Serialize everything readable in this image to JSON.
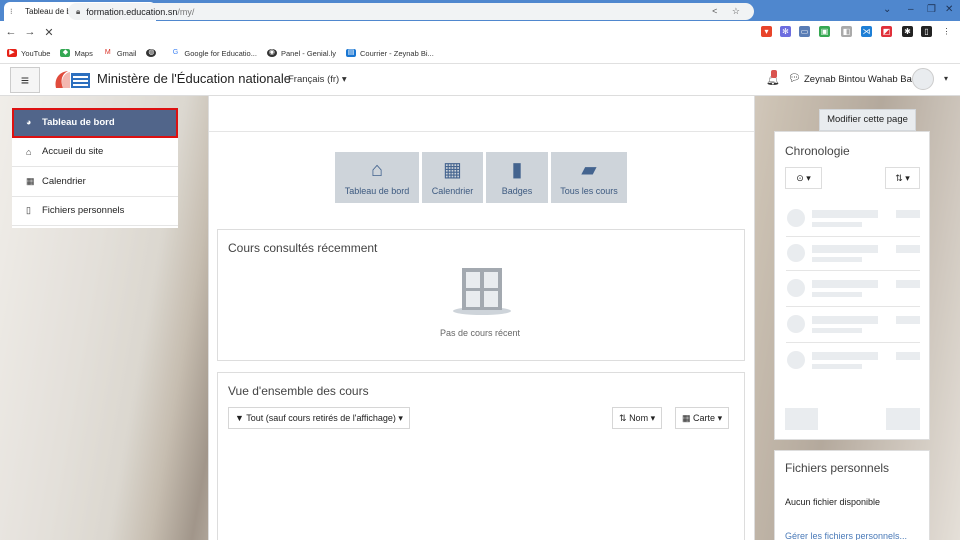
{
  "browser": {
    "tab_title": "Tableau de bord",
    "url_host": "formation.education.sn",
    "url_path": "/my/",
    "bookmarks": [
      "YouTube",
      "Maps",
      "Gmail",
      "",
      "Google for Educatio...",
      "Panel - Genial.ly",
      "Courrier - Zeynab Bi..."
    ]
  },
  "navbar": {
    "site_title": "Ministère de l'Éducation nationale",
    "language": "Français (fr)",
    "user_name": "Zeynab Bintou Wahab Ba"
  },
  "drawer": {
    "items": [
      {
        "label": "Tableau de bord",
        "icon": "dashboard-icon",
        "active": true
      },
      {
        "label": "Accueil du site",
        "icon": "home-icon"
      },
      {
        "label": "Calendrier",
        "icon": "calendar-icon"
      },
      {
        "label": "Fichiers personnels",
        "icon": "file-icon"
      }
    ]
  },
  "main": {
    "edit_button": "Modifier cette page",
    "quick_links": [
      {
        "label": "Tableau de bord",
        "icon": "home-icon"
      },
      {
        "label": "Calendrier",
        "icon": "calendar-icon"
      },
      {
        "label": "Badges",
        "icon": "bookmark-icon"
      },
      {
        "label": "Tous les cours",
        "icon": "book-icon"
      }
    ],
    "recent_title": "Cours consultés récemment",
    "recent_empty": "Pas de cours récent",
    "overview_title": "Vue d'ensemble des cours",
    "filter_label": "Tout (sauf cours retirés de l'affichage)",
    "sort_label": "Nom",
    "view_label": "Carte"
  },
  "right": {
    "timeline_title": "Chronologie",
    "files_title": "Fichiers personnels",
    "files_empty": "Aucun fichier disponible",
    "files_manage": "Gérer les fichiers personnels..."
  },
  "colors": {
    "active_item": "#51658a",
    "highlight_border": "#dd1111",
    "quick_link_bg": "#ced4da",
    "browser_tabbar": "#4f87ce"
  }
}
